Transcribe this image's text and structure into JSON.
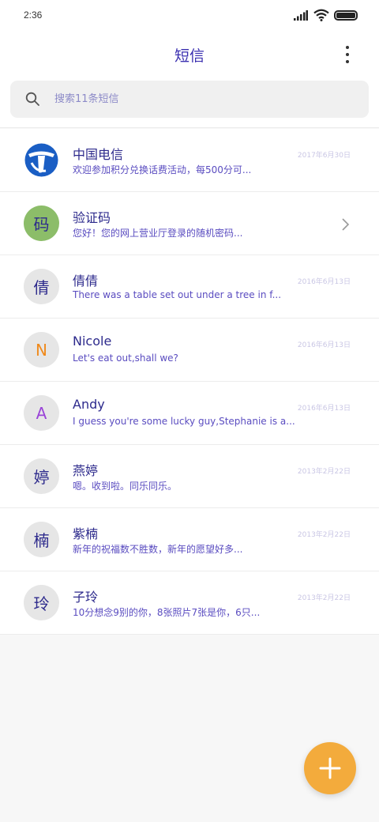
{
  "status_bar": {
    "time": "2:36",
    "battery_level": 1.0
  },
  "header": {
    "title": "短信",
    "more_icon": "more-vertical-icon"
  },
  "search": {
    "placeholder": "搜索11条短信",
    "icon": "search-icon"
  },
  "conversations": [
    {
      "avatar_type": "logo",
      "avatar_text": "",
      "name": "中国电信",
      "date": "2017年6月30日",
      "snippet": "欢迎参加积分兑换话费活动，每500分可..."
    },
    {
      "avatar_type": "text",
      "avatar_text": "码",
      "name": "验证码",
      "date": "",
      "snippet": "您好！您的网上营业厅登录的随机密码..."
    },
    {
      "avatar_type": "text",
      "avatar_text": "倩",
      "name": "倩倩",
      "date": "2016年6月13日",
      "snippet": "There was a table set out under a tree in f..."
    },
    {
      "avatar_type": "text",
      "avatar_text": "N",
      "name": "Nicole",
      "date": "2016年6月13日",
      "snippet": "Let's eat out,shall we?"
    },
    {
      "avatar_type": "text",
      "avatar_text": "A",
      "name": "Andy",
      "date": "2016年6月13日",
      "snippet": "I guess you're some lucky guy,Stephanie is a..."
    },
    {
      "avatar_type": "text",
      "avatar_text": "婷",
      "name": "燕婷",
      "date": "2013年2月22日",
      "snippet": "嗯。收到啦。同乐同乐。"
    },
    {
      "avatar_type": "text",
      "avatar_text": "楠",
      "name": "紫楠",
      "date": "2013年2月22日",
      "snippet": "新年的祝福数不胜数，新年的愿望好多..."
    },
    {
      "avatar_type": "text",
      "avatar_text": "玲",
      "name": "子玲",
      "date": "2013年2月22日",
      "snippet": "10分想念9别的你，8张照片7张是你，6只..."
    }
  ],
  "colors": {
    "accent": "#3a2fb0",
    "fab": "#f3ab3c",
    "avatar_green": "#8cbd69",
    "telecom_blue": "#1a5ec4"
  },
  "fab": {
    "icon": "plus-icon"
  }
}
